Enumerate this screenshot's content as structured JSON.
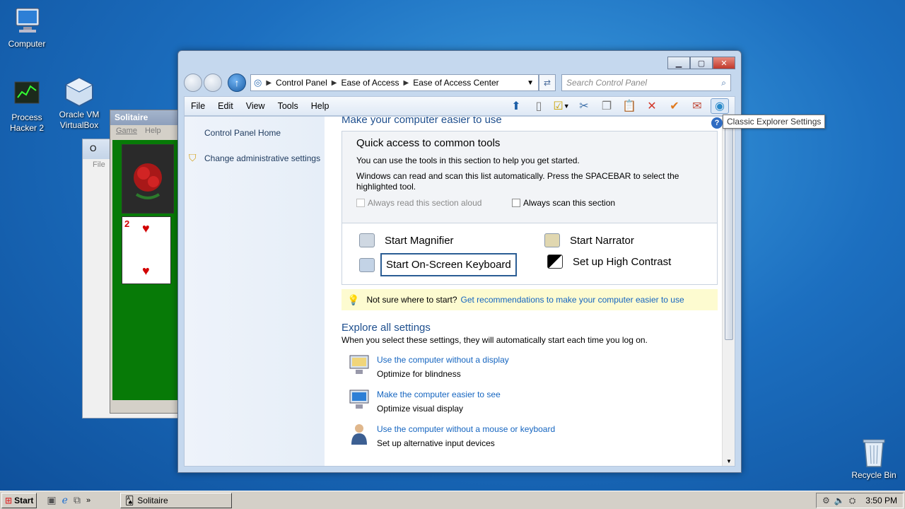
{
  "desktop": {
    "icons": [
      {
        "label": "Computer"
      },
      {
        "label": "Process Hacker 2"
      },
      {
        "label": "Oracle VM VirtualBox"
      },
      {
        "label": "Recycle Bin"
      }
    ]
  },
  "solitaire": {
    "title": "Solitaire",
    "menu": [
      "Game",
      "Help"
    ],
    "card_rank": "2",
    "card_suit": "♥"
  },
  "bg_window": {
    "title": "O",
    "menu_file": "File"
  },
  "explorer": {
    "address": [
      "Control Panel",
      "Ease of Access",
      "Ease of Access Center"
    ],
    "search_placeholder": "Search Control Panel",
    "menu": [
      "File",
      "Edit",
      "View",
      "Tools",
      "Help"
    ],
    "left_pane": {
      "home": "Control Panel Home",
      "admin": "Change administrative settings"
    },
    "main": {
      "heading": "Make your computer easier to use",
      "quick_title": "Quick access to common tools",
      "quick_desc1": "You can use the tools in this section to help you get started.",
      "quick_desc2": "Windows can read and scan this list automatically.  Press the SPACEBAR to select the highlighted tool.",
      "always_read": "Always read this section aloud",
      "always_scan": "Always scan this section",
      "tools": {
        "magnifier": "Start Magnifier",
        "narrator": "Start Narrator",
        "keyboard": "Start On-Screen Keyboard",
        "contrast": "Set up High Contrast"
      },
      "tip_prefix": "Not sure where to start?",
      "tip_link": "Get recommendations to make your computer easier to use",
      "explore_title": "Explore all settings",
      "explore_desc": "When you select these settings, they will automatically start each time you log on.",
      "settings": [
        {
          "link": "Use the computer without a display",
          "desc": "Optimize for blindness"
        },
        {
          "link": "Make the computer easier to see",
          "desc": "Optimize visual display"
        },
        {
          "link": "Use the computer without a mouse or keyboard",
          "desc": "Set up alternative input devices"
        }
      ]
    },
    "tooltip": "Classic Explorer Settings"
  },
  "taskbar": {
    "start": "Start",
    "task": "Solitaire",
    "clock": "3:50 PM"
  }
}
